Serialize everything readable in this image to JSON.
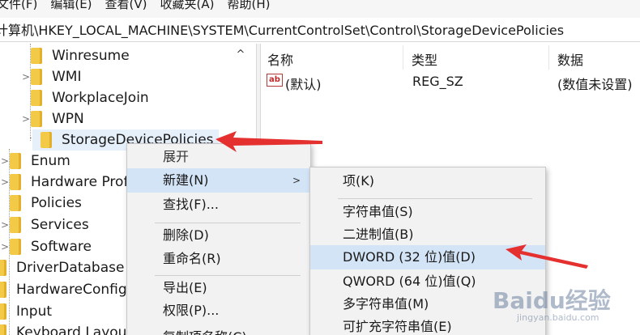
{
  "menubar": {
    "items": [
      "文件(F)",
      "编辑(E)",
      "查看(V)",
      "收藏夹(A)",
      "帮助(H)"
    ]
  },
  "address": {
    "path": "计算机\\HKEY_LOCAL_MACHINE\\SYSTEM\\CurrentControlSet\\Control\\StorageDevicePolicies"
  },
  "tree": {
    "items": [
      {
        "label": "Winresume",
        "expander": ""
      },
      {
        "label": "WMI",
        "expander": ">"
      },
      {
        "label": "WorkplaceJoin",
        "expander": ""
      },
      {
        "label": "WPN",
        "expander": ">"
      },
      {
        "label": "StorageDevicePolicies",
        "expander": ""
      },
      {
        "label": "Enum",
        "expander": ">"
      },
      {
        "label": "Hardware Profiles",
        "expander": ">"
      },
      {
        "label": "Policies",
        "expander": ""
      },
      {
        "label": "Services",
        "expander": ">"
      },
      {
        "label": "Software",
        "expander": ">"
      },
      {
        "label": "DriverDatabase",
        "expander": ""
      },
      {
        "label": "HardwareConfig",
        "expander": ""
      },
      {
        "label": "Input",
        "expander": ""
      },
      {
        "label": "Keyboard Layout",
        "expander": ""
      }
    ],
    "scroll_up": "^"
  },
  "list": {
    "headers": {
      "name": "名称",
      "type": "类型",
      "data": "数据"
    },
    "rows": [
      {
        "icon": "ab",
        "name": "(默认)",
        "type": "REG_SZ",
        "data": "(数值未设置)"
      }
    ]
  },
  "context_menu": {
    "items": [
      {
        "label": "展开",
        "disabled": false
      },
      {
        "label": "新建(N)",
        "has_submenu": true,
        "highlighted": true
      },
      {
        "label": "查找(F)..."
      },
      {
        "label": "删除(D)"
      },
      {
        "label": "重命名(R)"
      },
      {
        "label": "导出(E)"
      },
      {
        "label": "权限(P)..."
      },
      {
        "label": "复制项名称(C)"
      }
    ],
    "submenu_arrow": ">"
  },
  "submenu": {
    "items": [
      {
        "label": "项(K)"
      },
      {
        "label": "字符串值(S)"
      },
      {
        "label": "二进制值(B)"
      },
      {
        "label": "DWORD (32 位)值(D)",
        "highlighted": true
      },
      {
        "label": "QWORD (64 位)值(Q)"
      },
      {
        "label": "多字符串值(M)"
      },
      {
        "label": "可扩充字符串值(E)"
      }
    ]
  },
  "watermark": {
    "logo": "Baidu经验",
    "sub": "jingyan.baidu.com"
  },
  "colors": {
    "highlight": "#d4e4f7",
    "arrow_red": "#e53030",
    "folder": "#f3c948"
  }
}
